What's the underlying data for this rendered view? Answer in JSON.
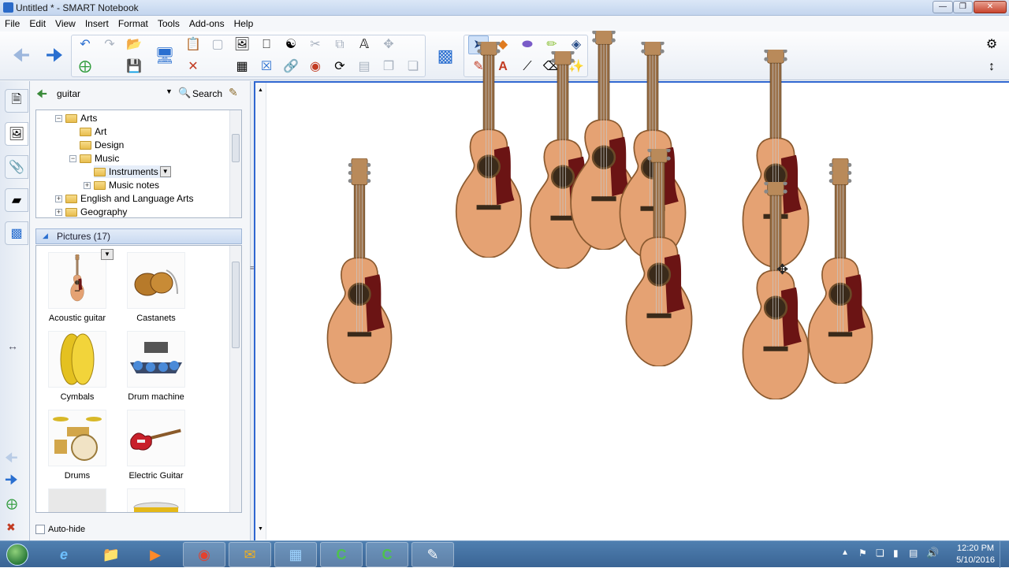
{
  "window": {
    "title": "Untitled * - SMART Notebook"
  },
  "menu": [
    "File",
    "Edit",
    "View",
    "Insert",
    "Format",
    "Tools",
    "Add-ons",
    "Help"
  ],
  "gallery": {
    "search_value": "guitar",
    "search_button": "Search",
    "tree": {
      "arts": "Arts",
      "art": "Art",
      "design": "Design",
      "music": "Music",
      "instruments": "Instruments",
      "music_notes": "Music notes",
      "english": "English and Language Arts",
      "geography": "Geography"
    },
    "pictures_header": "Pictures (17)",
    "pictures": [
      "Acoustic guitar",
      "Castanets",
      "Cymbals",
      "Drum machine",
      "Drums",
      "Electric Guitar"
    ],
    "autohide_label": "Auto-hide"
  },
  "taskbar": {
    "time": "12:20 PM",
    "date": "5/10/2016"
  },
  "colors": {
    "canvas_border": "#2f66d0",
    "guitar_body": "#e5a273",
    "pickguard": "#6b1414",
    "taskbar": "#3a6494"
  }
}
